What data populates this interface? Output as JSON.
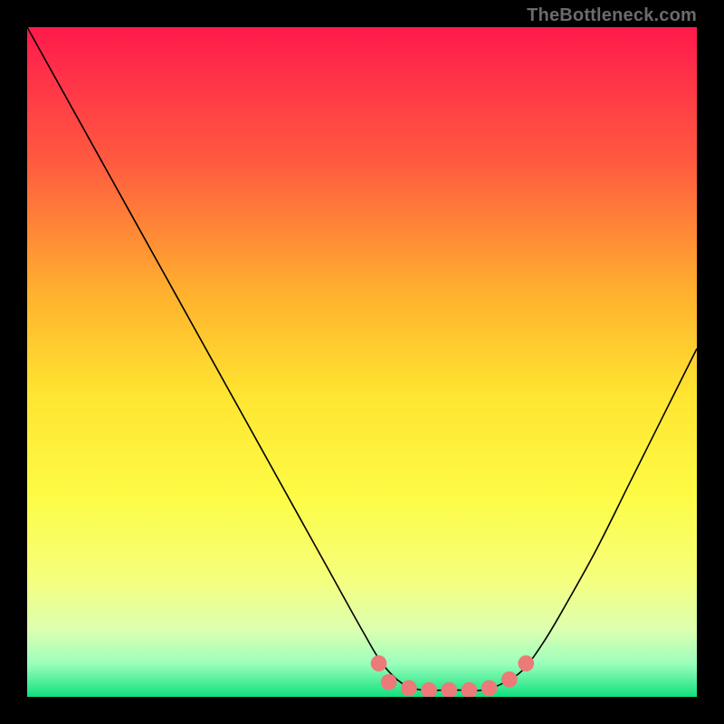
{
  "watermark": "TheBottleneck.com",
  "chart_data": {
    "type": "line",
    "title": "",
    "xlabel": "",
    "ylabel": "",
    "xlim": [
      0,
      100
    ],
    "ylim": [
      0,
      100
    ],
    "x": [
      0,
      5,
      10,
      15,
      20,
      25,
      30,
      35,
      40,
      45,
      50,
      53,
      56,
      59,
      62,
      65,
      68,
      71,
      74,
      77,
      80,
      85,
      90,
      95,
      100
    ],
    "values": [
      100,
      91,
      82,
      73,
      64,
      55,
      46,
      37,
      28,
      19,
      10,
      5,
      2,
      1,
      1,
      1,
      1,
      2,
      4,
      8,
      13,
      22,
      32,
      42,
      52
    ],
    "markers": {
      "x": [
        52.5,
        54,
        57,
        60,
        63,
        66,
        69,
        72,
        74.5
      ],
      "values": [
        5.0,
        2.2,
        1.3,
        1.0,
        1.0,
        1.0,
        1.3,
        2.6,
        5.0
      ],
      "color": "#ec7a78",
      "radius_pct": 1.2
    },
    "gradient_stops": [
      {
        "offset": 0.0,
        "color": "#ff1a4b"
      },
      {
        "offset": 0.05,
        "color": "#ff2a4a"
      },
      {
        "offset": 0.2,
        "color": "#ff5a3f"
      },
      {
        "offset": 0.4,
        "color": "#ffb22e"
      },
      {
        "offset": 0.55,
        "color": "#ffe531"
      },
      {
        "offset": 0.7,
        "color": "#fdfb45"
      },
      {
        "offset": 0.82,
        "color": "#f6ff7a"
      },
      {
        "offset": 0.9,
        "color": "#dcffb1"
      },
      {
        "offset": 0.95,
        "color": "#9cffbc"
      },
      {
        "offset": 1.0,
        "color": "#10e07f"
      }
    ],
    "curve_color": "#000000",
    "curve_width": 1.6
  }
}
